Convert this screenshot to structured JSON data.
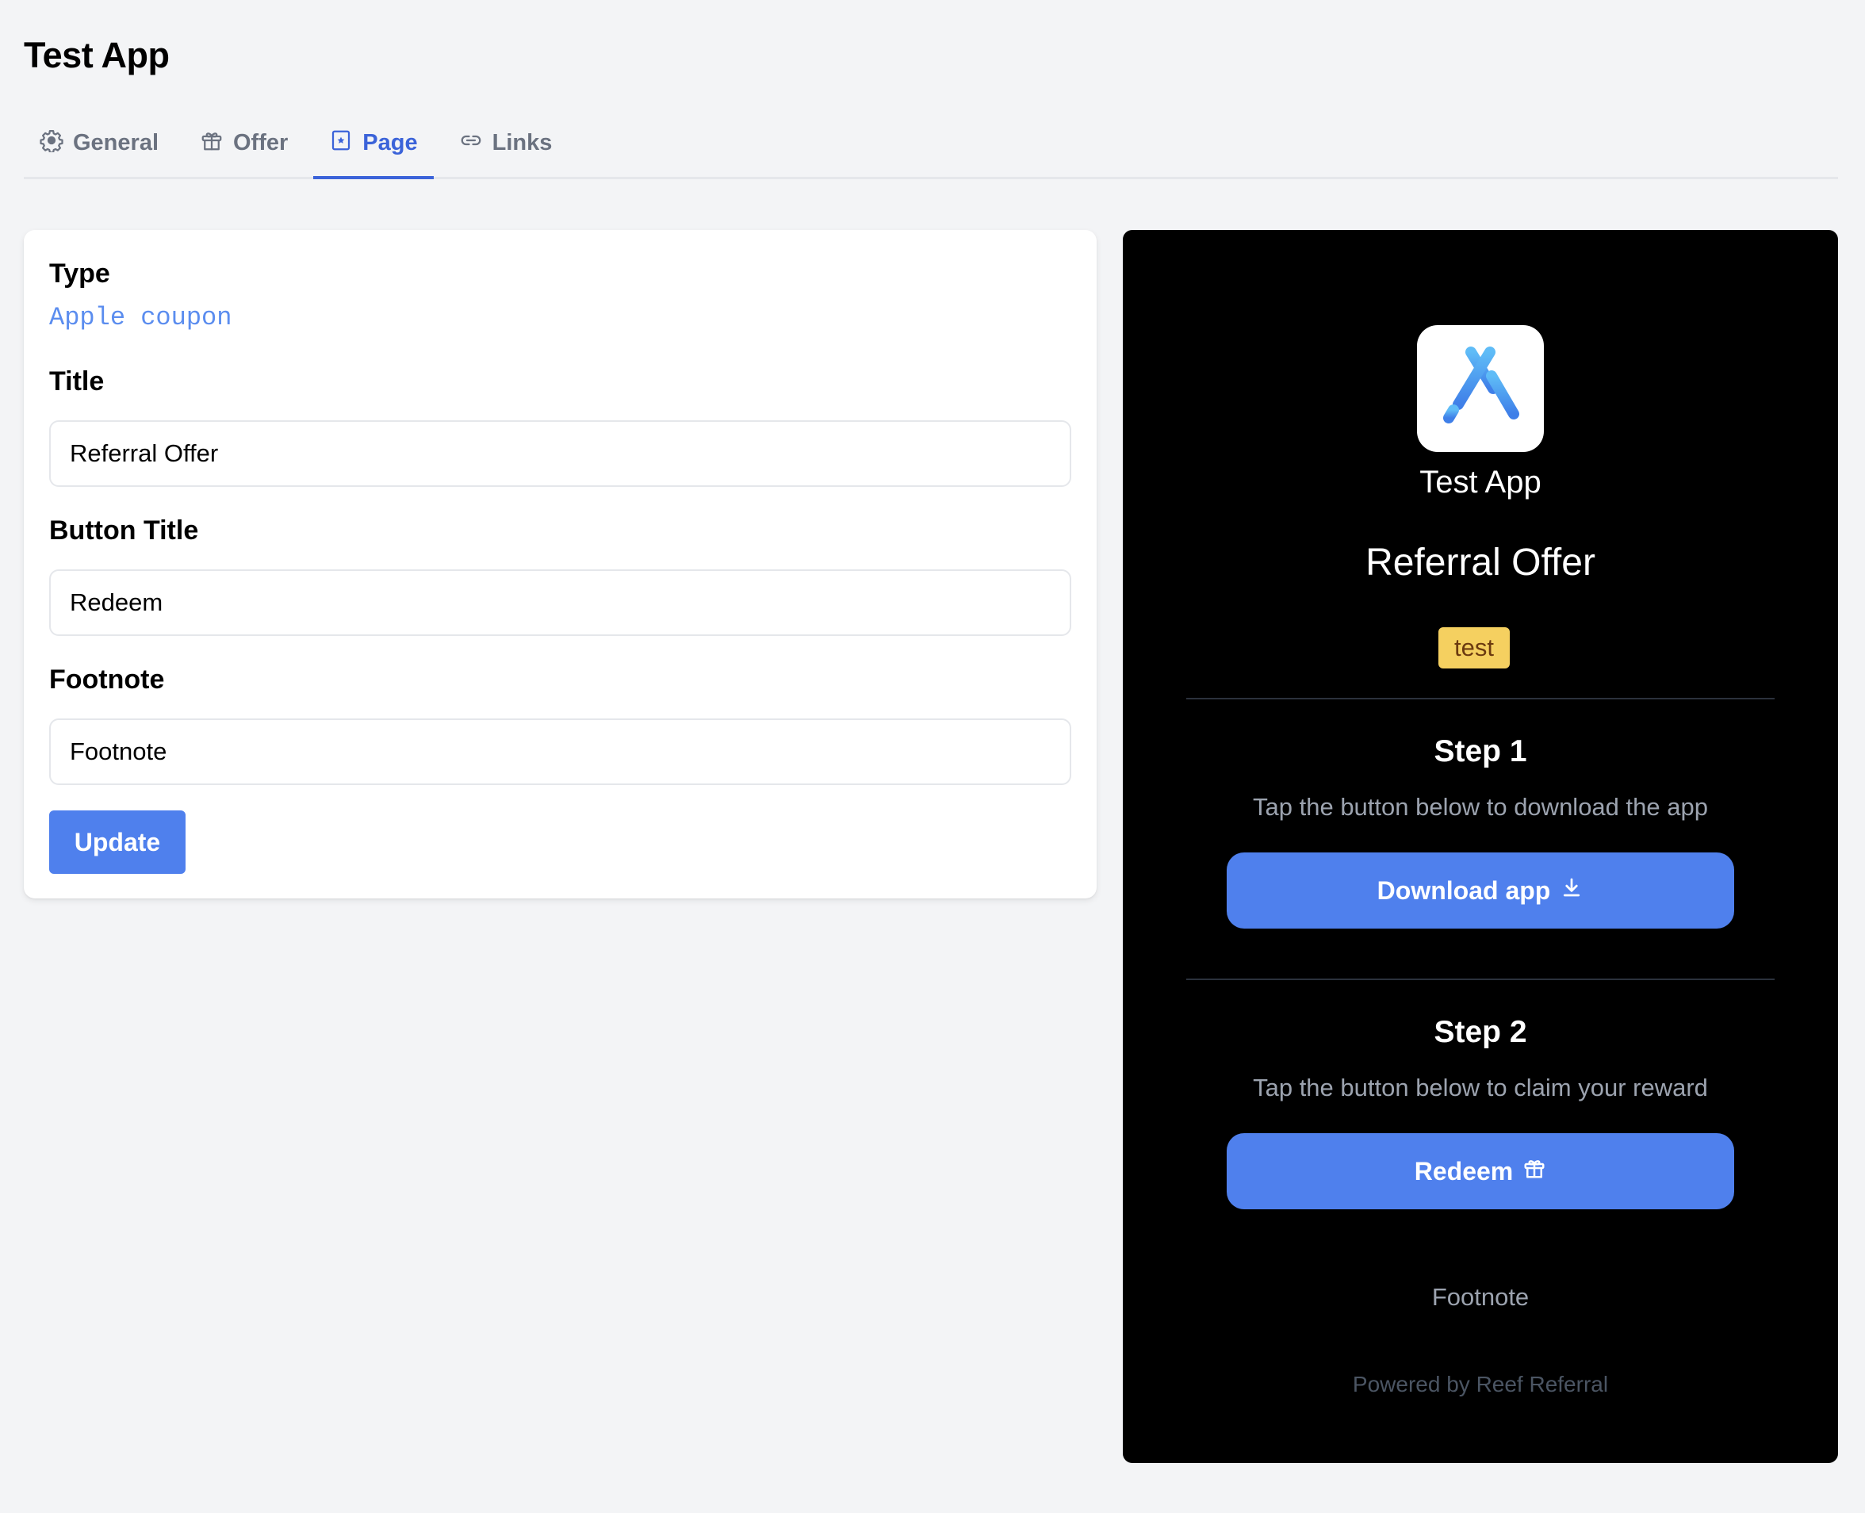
{
  "app": {
    "title": "Test App"
  },
  "tabs": [
    {
      "label": "General",
      "icon": "gear-icon",
      "active": false
    },
    {
      "label": "Offer",
      "icon": "gift-icon",
      "active": false
    },
    {
      "label": "Page",
      "icon": "star-square-icon",
      "active": true
    },
    {
      "label": "Links",
      "icon": "link-icon",
      "active": false
    }
  ],
  "form": {
    "type_label": "Type",
    "type_value": "Apple coupon",
    "title_label": "Title",
    "title_value": "Referral Offer",
    "button_title_label": "Button Title",
    "button_title_value": "Redeem",
    "footnote_label": "Footnote",
    "footnote_value": "Footnote",
    "update_label": "Update"
  },
  "preview": {
    "app_icon": "app-store-icon",
    "app_name": "Test App",
    "title": "Referral Offer",
    "badge": "test",
    "steps": [
      {
        "title": "Step 1",
        "description": "Tap the button below to download the app",
        "button_label": "Download app",
        "button_icon": "download-icon"
      },
      {
        "title": "Step 2",
        "description": "Tap the button below to claim your reward",
        "button_label": "Redeem",
        "button_icon": "gift-icon"
      }
    ],
    "footnote": "Footnote",
    "powered_by": "Powered by Reef Referral"
  },
  "colors": {
    "accent": "#4f80ed",
    "tab_active": "#3b63d9",
    "badge_bg": "#f5d060",
    "badge_text": "#6b3a10",
    "type_value": "#5b8def",
    "page_bg": "#f3f4f6",
    "preview_bg": "#000000"
  }
}
